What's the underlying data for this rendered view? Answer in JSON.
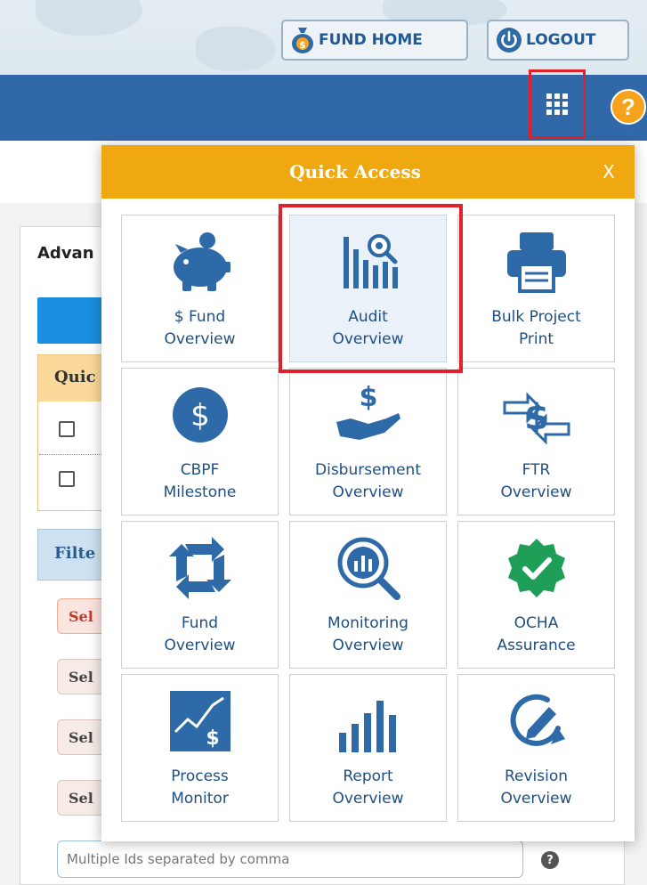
{
  "header": {
    "fund_home_label": "FUND HOME",
    "logout_label": "LOGOUT"
  },
  "background_page": {
    "panel_title": "Advan",
    "quick_section_label": "Quic",
    "filter_section_label": "Filte",
    "select_chip_label": "Sel",
    "ids_placeholder": "Multiple Ids separated by comma",
    "ids_help": "?"
  },
  "quick_access": {
    "title": "Quick Access",
    "close_label": "X",
    "tiles": [
      {
        "line1": "$ Fund",
        "line2": "Overview",
        "icon": "piggy-bank-icon"
      },
      {
        "line1": "Audit",
        "line2": "Overview",
        "icon": "audit-chart-icon",
        "highlighted": true
      },
      {
        "line1": "Bulk Project",
        "line2": "Print",
        "icon": "printer-icon"
      },
      {
        "line1": "CBPF",
        "line2": "Milestone",
        "icon": "dollar-circle-icon"
      },
      {
        "line1": "Disbursement",
        "line2": "Overview",
        "icon": "hand-dollar-icon"
      },
      {
        "line1": "FTR",
        "line2": "Overview",
        "icon": "transfer-dollar-icon"
      },
      {
        "line1": "Fund",
        "line2": "Overview",
        "icon": "refresh-cycle-icon"
      },
      {
        "line1": "Monitoring",
        "line2": "Overview",
        "icon": "magnifier-chart-icon"
      },
      {
        "line1": "OCHA",
        "line2": "Assurance",
        "icon": "verified-badge-icon"
      },
      {
        "line1": "Process",
        "line2": "Monitor",
        "icon": "trend-dollar-icon"
      },
      {
        "line1": "Report",
        "line2": "Overview",
        "icon": "bar-chart-icon"
      },
      {
        "line1": "Revision",
        "line2": "Overview",
        "icon": "revision-edit-icon"
      }
    ]
  },
  "colors": {
    "nav_blue": "#3068a8",
    "popup_header": "#efa810",
    "icon_blue": "#2f6aa8",
    "check_green": "#1f9e57",
    "highlight_red": "#e0202a"
  }
}
